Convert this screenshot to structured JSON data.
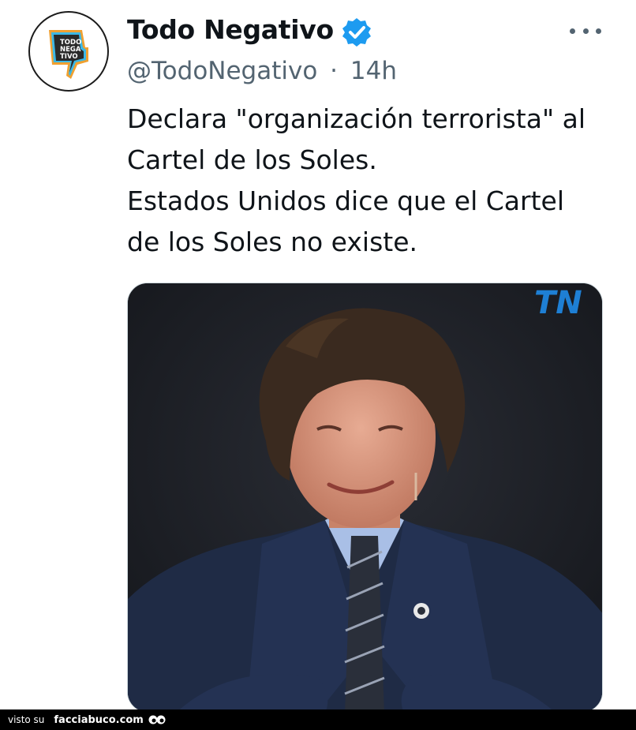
{
  "tweet": {
    "author": {
      "display_name": "Todo Negativo",
      "handle": "@TodoNegativo",
      "avatar_text": [
        "TODO",
        "NEGA",
        "TIVO"
      ],
      "verified": true
    },
    "separator": "·",
    "time": "14h",
    "text_lines": [
      "Declara \"organización terrorista\" al",
      "Cartel de los Soles.",
      "Estados Unidos dice que el Cartel",
      "de los Soles no existe."
    ],
    "media": {
      "watermark": "TN"
    }
  },
  "footer": {
    "prefix": "visto su",
    "site": "facciabuco.com"
  },
  "colors": {
    "verified": "#1d9bf0",
    "secondary_text": "#536471",
    "tn_blue": "#1e7fd4",
    "tn_red": "#e3262f"
  },
  "icons": {
    "verified": "verified-badge-icon",
    "more": "more-dots-icon",
    "avatar": "thumbs-down-logo-icon",
    "footer": "eyes-icon"
  }
}
